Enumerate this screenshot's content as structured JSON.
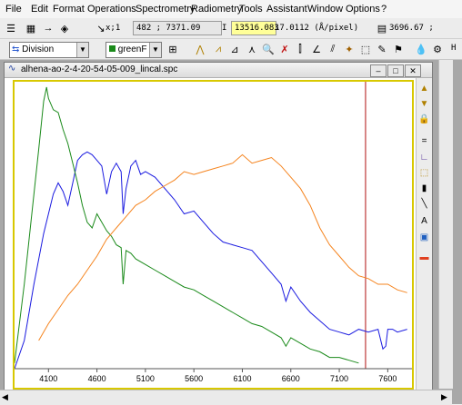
{
  "menu": {
    "items": [
      "File",
      "Edit",
      "Format",
      "Operations",
      "Spectrometry",
      "Radiometry",
      "Tools",
      "Assistant",
      "Window",
      "Options",
      "?"
    ]
  },
  "toolbar": {
    "x_label": "x;1",
    "cursor_readout": "482 ; 7371.09",
    "intensity_label": "I",
    "intensity_value": "13516.083",
    "dispersion": "17.0112 (Å/pixel)",
    "right_readout": "3696.67 ;",
    "operation_select": "Division",
    "color_select": "greenF",
    "hint_letter": "H"
  },
  "window": {
    "title": "alhena-ao-2-4-20-54-05-009_lincal.spc"
  },
  "colors": {
    "blue": "#1a1ae0",
    "green": "#1a8a1a",
    "orange": "#f5841f",
    "marker": "#b01010",
    "frame": "#d8c800"
  },
  "chart_data": {
    "type": "line",
    "xlabel": "",
    "ylabel": "",
    "xlim": [
      3750,
      7850
    ],
    "ylim": [
      0,
      1
    ],
    "x_ticks": [
      4100,
      4600,
      5100,
      5600,
      6100,
      6600,
      7100,
      7600
    ],
    "marker_x": 7371.09,
    "series": [
      {
        "color": "blue",
        "x": [
          3750,
          3850,
          3950,
          4050,
          4100,
          4150,
          4200,
          4250,
          4300,
          4350,
          4400,
          4450,
          4500,
          4550,
          4600,
          4650,
          4700,
          4750,
          4800,
          4850,
          4870,
          4900,
          4950,
          5000,
          5050,
          5100,
          5200,
          5300,
          5400,
          5500,
          5600,
          5700,
          5800,
          5900,
          6000,
          6100,
          6200,
          6300,
          6400,
          6500,
          6550,
          6600,
          6700,
          6800,
          6900,
          7000,
          7100,
          7200,
          7300,
          7400,
          7500,
          7550,
          7580,
          7600,
          7650,
          7700,
          7800
        ],
        "y": [
          0.0,
          0.1,
          0.3,
          0.48,
          0.55,
          0.62,
          0.66,
          0.63,
          0.58,
          0.66,
          0.74,
          0.76,
          0.77,
          0.76,
          0.74,
          0.72,
          0.62,
          0.7,
          0.73,
          0.7,
          0.55,
          0.64,
          0.72,
          0.74,
          0.69,
          0.7,
          0.68,
          0.64,
          0.6,
          0.55,
          0.56,
          0.52,
          0.48,
          0.45,
          0.44,
          0.43,
          0.42,
          0.38,
          0.34,
          0.3,
          0.24,
          0.29,
          0.24,
          0.2,
          0.17,
          0.14,
          0.13,
          0.12,
          0.14,
          0.13,
          0.14,
          0.07,
          0.08,
          0.14,
          0.14,
          0.13,
          0.14
        ]
      },
      {
        "color": "green",
        "x": [
          3750,
          3850,
          3950,
          4000,
          4050,
          4080,
          4100,
          4150,
          4200,
          4250,
          4300,
          4350,
          4400,
          4450,
          4500,
          4550,
          4600,
          4650,
          4700,
          4750,
          4800,
          4850,
          4870,
          4900,
          4950,
          5000,
          5100,
          5200,
          5300,
          5400,
          5500,
          5600,
          5700,
          5800,
          5900,
          6000,
          6100,
          6200,
          6300,
          6400,
          6500,
          6550,
          6600,
          6700,
          6800,
          6900,
          7000,
          7100,
          7200,
          7300
        ],
        "y": [
          0.02,
          0.3,
          0.62,
          0.78,
          0.95,
          1.0,
          0.96,
          0.92,
          0.91,
          0.85,
          0.8,
          0.73,
          0.66,
          0.58,
          0.52,
          0.5,
          0.55,
          0.52,
          0.49,
          0.47,
          0.44,
          0.43,
          0.3,
          0.42,
          0.41,
          0.39,
          0.37,
          0.35,
          0.33,
          0.31,
          0.29,
          0.28,
          0.26,
          0.24,
          0.22,
          0.2,
          0.18,
          0.16,
          0.15,
          0.13,
          0.11,
          0.08,
          0.11,
          0.09,
          0.07,
          0.06,
          0.04,
          0.04,
          0.03,
          0.02
        ]
      },
      {
        "color": "orange",
        "x": [
          4000,
          4100,
          4200,
          4300,
          4400,
          4500,
          4600,
          4700,
          4800,
          4900,
          5000,
          5100,
          5200,
          5300,
          5400,
          5500,
          5600,
          5700,
          5800,
          5900,
          6000,
          6100,
          6200,
          6300,
          6400,
          6500,
          6600,
          6700,
          6800,
          6900,
          7000,
          7100,
          7200,
          7300,
          7400,
          7500,
          7600,
          7700,
          7800
        ],
        "y": [
          0.1,
          0.16,
          0.21,
          0.26,
          0.3,
          0.35,
          0.4,
          0.46,
          0.5,
          0.54,
          0.58,
          0.6,
          0.63,
          0.65,
          0.67,
          0.7,
          0.69,
          0.7,
          0.71,
          0.72,
          0.73,
          0.76,
          0.73,
          0.74,
          0.75,
          0.72,
          0.68,
          0.64,
          0.58,
          0.5,
          0.44,
          0.4,
          0.36,
          0.33,
          0.32,
          0.3,
          0.3,
          0.28,
          0.27
        ]
      }
    ]
  }
}
